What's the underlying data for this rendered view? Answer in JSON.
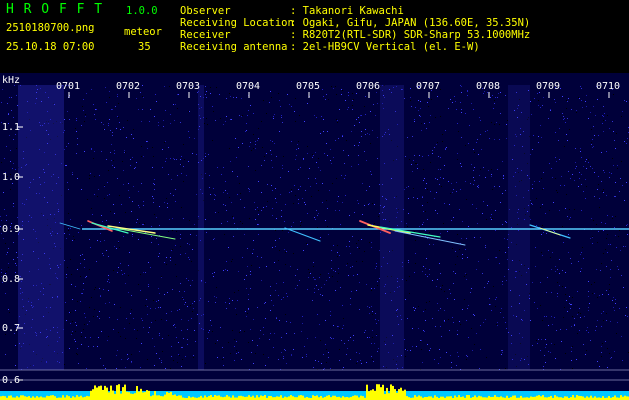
{
  "header": {
    "logo": "H R O F F T",
    "version": "1.0.0",
    "filename": "2510180700.png",
    "datetime": "25.10.18 07:00",
    "meteor_label": "meteor",
    "meteor_count": "35",
    "fields": [
      {
        "label": "Observer",
        "value": ": Takanori Kawachi"
      },
      {
        "label": "Receiving Location",
        "value": ": Ogaki, Gifu, JAPAN (136.60E, 35.35N)"
      },
      {
        "label": "Receiver",
        "value": ": R820T2(RTL-SDR) SDR-Sharp 53.1000MHz"
      },
      {
        "label": "Receiving antenna",
        "value": ": 2el-HB9CV Vertical (el. E-W)"
      }
    ]
  },
  "axis": {
    "unit": "kHz",
    "time_ticks": [
      "0701",
      "0702",
      "0703",
      "0704",
      "0705",
      "0706",
      "0707",
      "0708",
      "0709",
      "0710"
    ],
    "freq_ticks": [
      "1.1",
      "1.0",
      "0.9",
      "0.8",
      "0.7",
      "0.6"
    ]
  },
  "colors": {
    "background": "#00003a",
    "header_text_green": "#00ff00",
    "header_text_yellow": "#ffff00",
    "carrier_line": "#40c0ff",
    "bottom_activity": "#ffff00",
    "bottom_baseline": "#00c8ff"
  }
}
